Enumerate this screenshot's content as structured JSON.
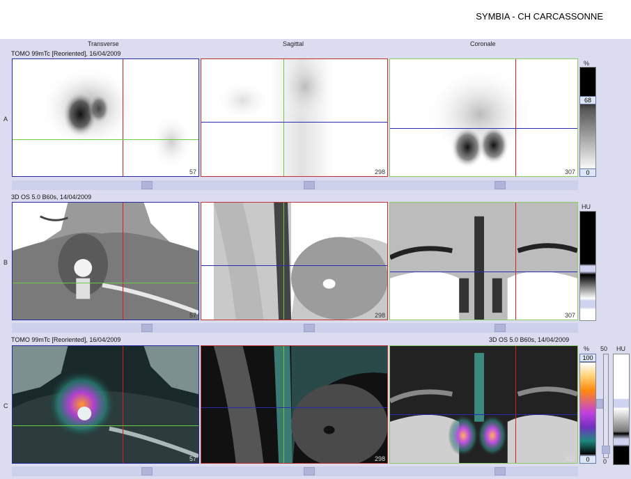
{
  "app": {
    "title": "SYMBIA - CH CARCASSONNE"
  },
  "columns": {
    "transverse": "Transverse",
    "sagittal": "Sagittal",
    "coronal": "Coronale"
  },
  "rows": {
    "a": {
      "label": "A",
      "series": "TOMO 99mTc [Reoriented], 16/04/2009",
      "slices": [
        "57",
        "298",
        "307"
      ]
    },
    "b": {
      "label": "B",
      "series": "3D  OS  5.0  B60s, 14/04/2009",
      "slices": [
        "57",
        "298",
        "307"
      ]
    },
    "c": {
      "label": "C",
      "series_left": "TOMO 99mTc [Reoriented], 16/04/2009",
      "series_right": "3D  OS  5.0  B60s, 14/04/2009",
      "slices": [
        "57",
        "298",
        "307"
      ]
    }
  },
  "colorbars": {
    "a": {
      "unit": "%",
      "value": "68",
      "min": "0"
    },
    "b": {
      "unit": "HU"
    },
    "c": {
      "unit": "%",
      "max": "100",
      "min": "0",
      "ct_unit": "HU",
      "ct_value": "50",
      "ct_min": "0"
    }
  },
  "colors": {
    "transverse_border": "#2828a0",
    "sagittal_border": "#c03030",
    "coronal_border": "#8ccc66"
  }
}
